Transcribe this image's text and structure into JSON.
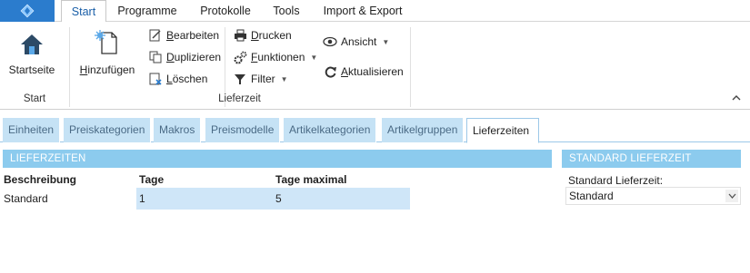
{
  "menubar": {
    "tabs": [
      {
        "label": "Start",
        "active": true
      },
      {
        "label": "Programme",
        "active": false
      },
      {
        "label": "Protokolle",
        "active": false
      },
      {
        "label": "Tools",
        "active": false
      },
      {
        "label": "Import & Export",
        "active": false
      }
    ]
  },
  "ribbon": {
    "groups": {
      "start": "Start",
      "lieferzeit": "Lieferzeit"
    },
    "buttons": {
      "startseite": "Startseite",
      "hinzufuegen_pre": "H",
      "hinzufuegen_rest": "inzufügen",
      "bearbeiten_pre": "B",
      "bearbeiten_rest": "earbeiten",
      "duplizieren_pre": "D",
      "duplizieren_rest": "uplizieren",
      "loeschen_pre": "L",
      "loeschen_rest": "öschen",
      "drucken_pre": "D",
      "drucken_rest": "rucken",
      "funktionen_pre": "F",
      "funktionen_rest": "unktionen",
      "filter": "Filter",
      "ansicht": "Ansicht",
      "aktualisieren_pre": "A",
      "aktualisieren_rest": "ktualisieren"
    },
    "collapse_icon": "chevron-up-icon"
  },
  "subtabs": [
    {
      "label": "Einheiten",
      "active": false
    },
    {
      "label": "Preiskategorien",
      "active": false
    },
    {
      "label": "Makros",
      "active": false
    },
    {
      "label": "Preismodelle",
      "active": false
    },
    {
      "label": "Artikelkategorien",
      "active": false
    },
    {
      "label": "Artikelgruppen",
      "active": false
    },
    {
      "label": "Lieferzeiten",
      "active": true
    }
  ],
  "list_section": {
    "title": "LIEFERZEITEN",
    "columns": [
      "Beschreibung",
      "Tage",
      "Tage maximal"
    ],
    "rows": [
      {
        "beschreibung": "Standard",
        "tage": "1",
        "tage_maximal": "5"
      }
    ]
  },
  "detail_section": {
    "title": "STANDARD LIEFERZEIT",
    "field_label": "Standard Lieferzeit:",
    "field_value": "Standard"
  },
  "colors": {
    "accent": "#2b7ccd",
    "section_header": "#8ccbee",
    "tab_inactive": "#c5e2f5",
    "row_selected": "#cfe6f8"
  }
}
